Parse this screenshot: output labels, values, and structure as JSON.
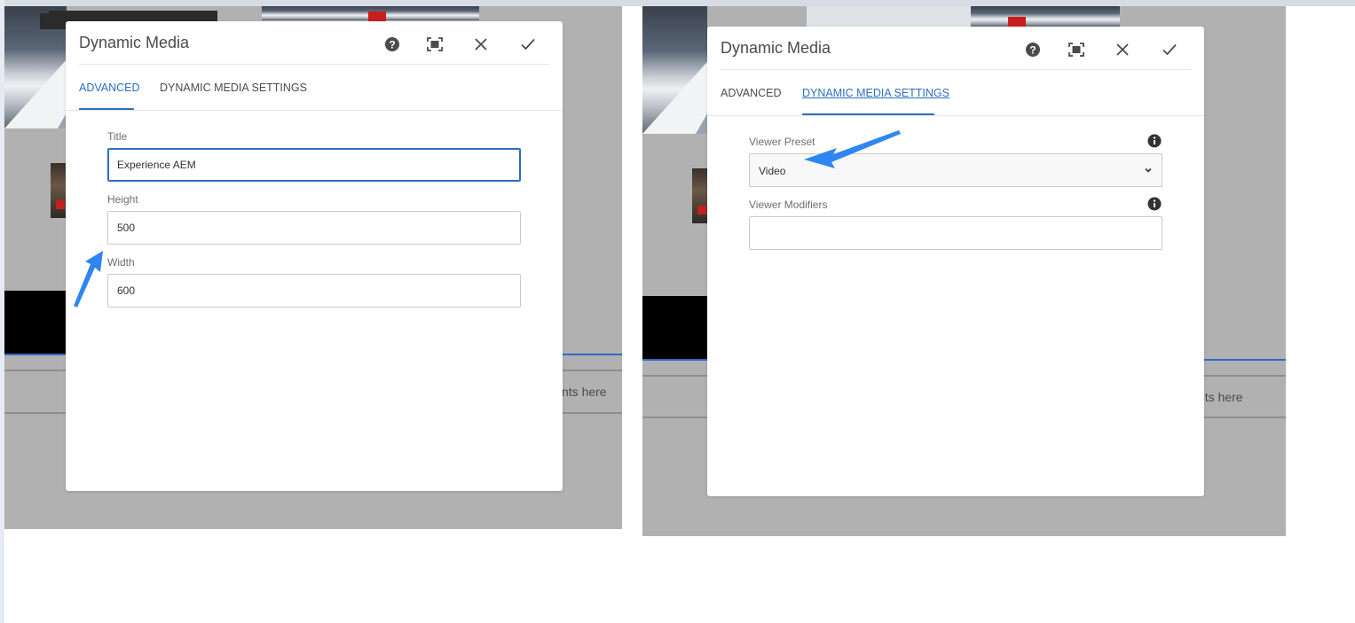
{
  "colors": {
    "accent": "#2c6ebf",
    "overlay": "#b1b1b1",
    "arrow": "#2f86f0"
  },
  "background": {
    "right_text_left": "nts here",
    "right_text_right": "nts here"
  },
  "left_dialog": {
    "title": "Dynamic Media",
    "header_icons": [
      "help-icon",
      "fullscreen-icon",
      "close-icon",
      "check-icon"
    ],
    "tabs": [
      {
        "label": "ADVANCED",
        "active": true
      },
      {
        "label": "DYNAMIC MEDIA SETTINGS",
        "active": false
      }
    ],
    "fields": {
      "title": {
        "label": "Title",
        "value": "Experience AEM"
      },
      "height": {
        "label": "Height",
        "value": "500"
      },
      "width": {
        "label": "Width",
        "value": "600"
      }
    }
  },
  "right_dialog": {
    "title": "Dynamic Media",
    "header_icons": [
      "help-icon",
      "fullscreen-icon",
      "close-icon",
      "check-icon"
    ],
    "tabs": [
      {
        "label": "ADVANCED",
        "active": false
      },
      {
        "label": "DYNAMIC MEDIA SETTINGS",
        "active": true
      }
    ],
    "fields": {
      "viewer_preset": {
        "label": "Viewer Preset",
        "value": "Video"
      },
      "viewer_modifiers": {
        "label": "Viewer Modifiers",
        "value": ""
      }
    }
  }
}
